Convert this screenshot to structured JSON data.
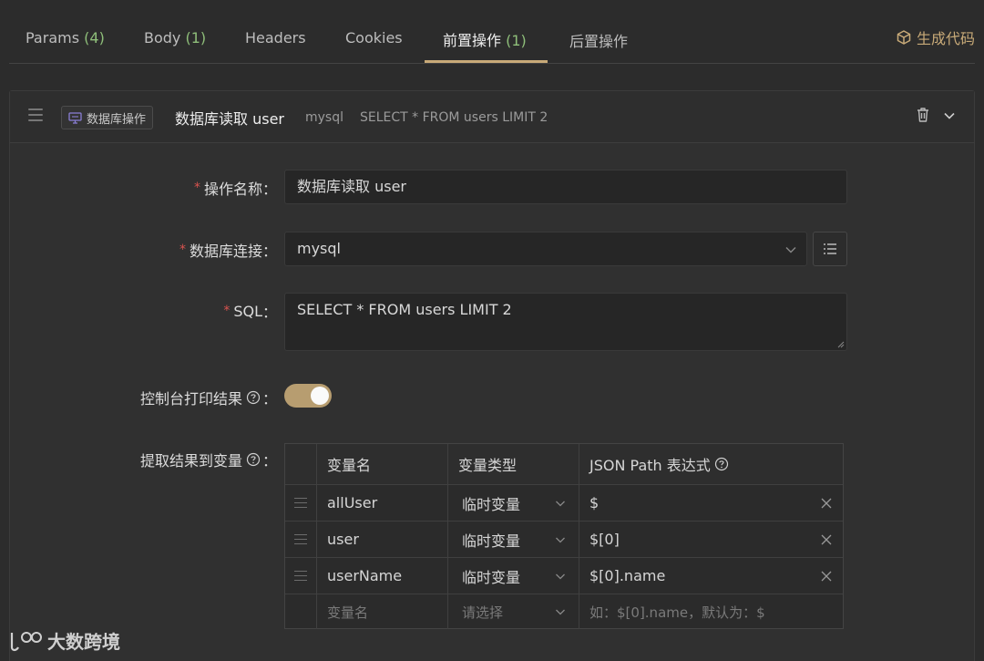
{
  "tabs": [
    {
      "label": "Params",
      "count": "(4)"
    },
    {
      "label": "Body",
      "count": "(1)"
    },
    {
      "label": "Headers",
      "count": ""
    },
    {
      "label": "Cookies",
      "count": ""
    },
    {
      "label": "前置操作",
      "count": "(1)"
    },
    {
      "label": "后置操作",
      "count": ""
    }
  ],
  "generate_code_label": "生成代码",
  "accent_color": "#c8aa78",
  "operation": {
    "type_badge": "数据库操作",
    "title": "数据库读取 user",
    "db": "mysql",
    "sql_preview": "SELECT * FROM users LIMIT 2"
  },
  "form": {
    "name_label": "操作名称",
    "name_value": "数据库读取 user",
    "db_label": "数据库连接",
    "db_value": "mysql",
    "sql_label": "SQL",
    "sql_value": "SELECT * FROM users LIMIT 2",
    "print_label": "控制台打印结果",
    "print_enabled": true,
    "extract_label": "提取结果到变量",
    "colon": "："
  },
  "table": {
    "headers": {
      "name": "变量名",
      "type": "变量类型",
      "path": "JSON Path 表达式"
    },
    "rows": [
      {
        "name": "allUser",
        "type": "临时变量",
        "path": "$"
      },
      {
        "name": "user",
        "type": "临时变量",
        "path": "$[0]"
      },
      {
        "name": "userName",
        "type": "临时变量",
        "path": "$[0].name"
      }
    ],
    "new_row": {
      "name_placeholder": "变量名",
      "type_placeholder": "请选择",
      "path_placeholder": "如：$[0].name，默认为：$"
    }
  },
  "watermark": "大数跨境"
}
